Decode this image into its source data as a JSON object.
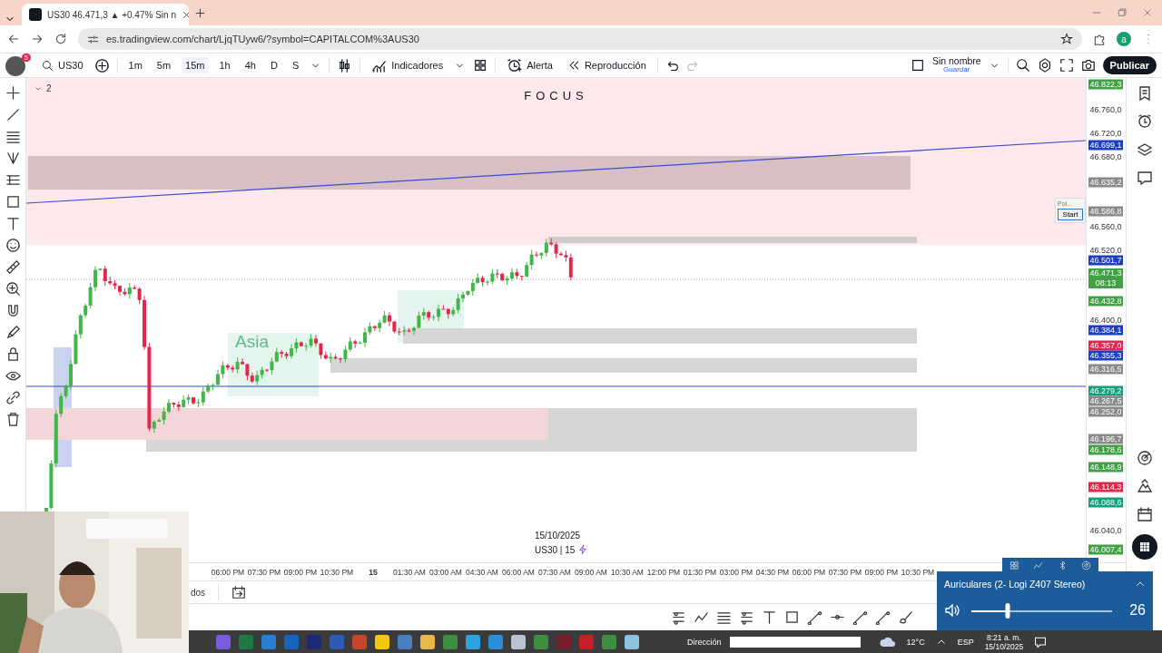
{
  "browser": {
    "tab_title": "US30 46.471,3 ▲ +0.47% Sin n",
    "url": "es.tradingview.com/chart/LjqTUyw6/?symbol=CAPITALCOM%3AUS30",
    "profile_initial": "a"
  },
  "toolbar": {
    "notification_count": "5",
    "symbol": "US30",
    "intervals": [
      {
        "label": "1m",
        "selected": false
      },
      {
        "label": "5m",
        "selected": false
      },
      {
        "label": "15m",
        "selected": true
      },
      {
        "label": "1h",
        "selected": false
      },
      {
        "label": "4h",
        "selected": false
      },
      {
        "label": "D",
        "selected": false
      },
      {
        "label": "S",
        "selected": false
      }
    ],
    "indicators": "Indicadores",
    "alert": "Alerta",
    "replay": "Reproducción",
    "layout_name": "Sin nombre",
    "layout_action": "Guardar",
    "publish": "Publicar"
  },
  "chart": {
    "title": "FOCUS",
    "pane_count": "2",
    "session_label": "Asia",
    "date": "15/10/2025",
    "legend": "US30 | 15",
    "price_labels": [
      {
        "text": "46.822,3",
        "kind": "badge",
        "color": "#43a047"
      },
      {
        "text": "46.760,0",
        "kind": "tick"
      },
      {
        "text": "46.720,0",
        "kind": "tick"
      },
      {
        "text": "46.699,1",
        "kind": "badge",
        "color": "#1e3fbf"
      },
      {
        "text": "46.680,0",
        "kind": "tick"
      },
      {
        "text": "46.635,2",
        "kind": "badge",
        "color": "#8a8a8a"
      },
      {
        "text": "46.586,8",
        "kind": "badge",
        "color": "#8a8a8a"
      },
      {
        "text": "46.560,0",
        "kind": "tick"
      },
      {
        "text": "46.520,0",
        "kind": "tick"
      },
      {
        "text": "46.501,7",
        "kind": "badge",
        "color": "#1e3fbf"
      },
      {
        "text": "46.471,3",
        "kind": "badge",
        "color": "#43a047",
        "countdown": "08:13"
      },
      {
        "text": "46.432,8",
        "kind": "badge",
        "color": "#43a047"
      },
      {
        "text": "46.400,0",
        "kind": "tick"
      },
      {
        "text": "46.384,1",
        "kind": "badge",
        "color": "#1e3fbf"
      },
      {
        "text": "46.357,0",
        "kind": "badge",
        "color": "#e0284f"
      },
      {
        "text": "46.355,3",
        "kind": "badge",
        "color": "#1e3fbf"
      },
      {
        "text": "46.316,5",
        "kind": "badge",
        "color": "#8a8a8a"
      },
      {
        "text": "46.279,2",
        "kind": "badge",
        "color": "#13a07a"
      },
      {
        "text": "46.267,5",
        "kind": "badge",
        "color": "#8a8a8a"
      },
      {
        "text": "46.252,0",
        "kind": "badge",
        "color": "#8a8a8a"
      },
      {
        "text": "46.196,7",
        "kind": "badge",
        "color": "#8a8a8a"
      },
      {
        "text": "46.178,6",
        "kind": "badge",
        "color": "#43a047"
      },
      {
        "text": "46.148,9",
        "kind": "badge",
        "color": "#43a047"
      },
      {
        "text": "46.114,3",
        "kind": "badge",
        "color": "#e0284f"
      },
      {
        "text": "46.088,6",
        "kind": "badge",
        "color": "#13a07a"
      },
      {
        "text": "46.040,0",
        "kind": "tick"
      },
      {
        "text": "46.007,4",
        "kind": "badge",
        "color": "#43a047"
      }
    ],
    "time_labels": [
      "06:00 PM",
      "07:30 PM",
      "09:00 PM",
      "10:30 PM",
      "15",
      "01:30 AM",
      "03:00 AM",
      "04:30 AM",
      "06:00 AM",
      "07:30 AM",
      "09:00 AM",
      "10:30 AM",
      "12:00 PM",
      "01:30 PM",
      "03:00 PM",
      "04:30 PM",
      "06:00 PM",
      "07:30 PM",
      "09:00 PM",
      "10:30 PM"
    ]
  },
  "popup": {
    "placeholder": "Poi...",
    "button": "Start"
  },
  "bottom_bar": {
    "text": "dos"
  },
  "taskbar": {
    "address_label": "Dirección",
    "temperature": "12°C",
    "language": "ESP",
    "time": "8:21 a. m.",
    "date": "15/10/2025"
  },
  "volume": {
    "device": "Auriculares (2- Logi Z407 Stereo)",
    "level": 0.26,
    "reading": "26"
  }
}
